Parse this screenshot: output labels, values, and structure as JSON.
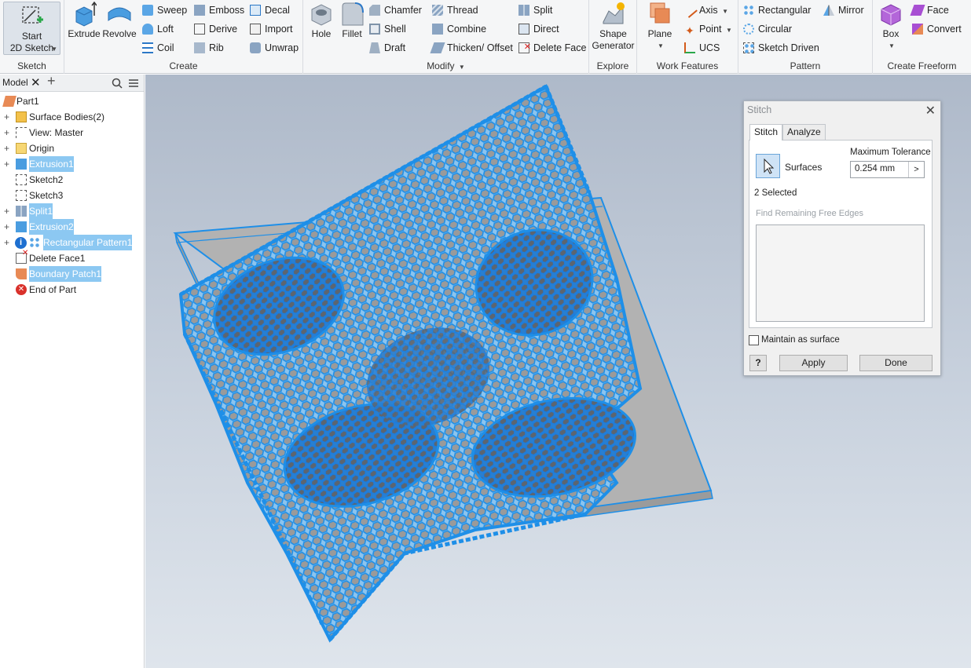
{
  "ribbon": {
    "sketch": {
      "start_label_1": "Start",
      "start_label_2": "2D Sketch",
      "panel": "Sketch"
    },
    "create": {
      "extrude": "Extrude",
      "revolve": "Revolve",
      "sweep": "Sweep",
      "loft": "Loft",
      "coil": "Coil",
      "emboss": "Emboss",
      "derive": "Derive",
      "rib": "Rib",
      "decal": "Decal",
      "import": "Import",
      "unwrap": "Unwrap",
      "panel": "Create"
    },
    "modify": {
      "hole": "Hole",
      "fillet": "Fillet",
      "chamfer": "Chamfer",
      "shell": "Shell",
      "draft": "Draft",
      "thread": "Thread",
      "combine": "Combine",
      "thicken": "Thicken/ Offset",
      "split": "Split",
      "direct": "Direct",
      "delete_face": "Delete Face",
      "panel": "Modify"
    },
    "explore": {
      "shape_1": "Shape",
      "shape_2": "Generator",
      "panel": "Explore"
    },
    "work_features": {
      "plane": "Plane",
      "axis": "Axis",
      "point": "Point",
      "ucs": "UCS",
      "panel": "Work Features"
    },
    "pattern": {
      "rectangular": "Rectangular",
      "circular": "Circular",
      "sketch_driven": "Sketch Driven",
      "mirror": "Mirror",
      "panel": "Pattern"
    },
    "freeform": {
      "box": "Box",
      "face": "Face",
      "convert": "Convert",
      "panel": "Create Freeform"
    }
  },
  "browser": {
    "tab": "Model",
    "items": [
      {
        "label": "Part1"
      },
      {
        "label": "Surface Bodies(2)"
      },
      {
        "label": "View: Master"
      },
      {
        "label": "Origin"
      },
      {
        "label": "Extrusion1"
      },
      {
        "label": "Sketch2"
      },
      {
        "label": "Sketch3"
      },
      {
        "label": "Split1"
      },
      {
        "label": "Extrusion2"
      },
      {
        "label": "Rectangular Pattern1"
      },
      {
        "label": "Delete Face1"
      },
      {
        "label": "Boundary Patch1"
      },
      {
        "label": "End of Part"
      }
    ]
  },
  "dialog": {
    "title": "Stitch",
    "tabs": [
      "Stitch",
      "Analyze"
    ],
    "surfaces_label": "Surfaces",
    "tolerance_label": "Maximum Tolerance",
    "tolerance_value": "0.254 mm",
    "selected_count": "2 Selected",
    "find_edges": "Find Remaining Free Edges",
    "maintain_label": "Maintain as surface",
    "apply": "Apply",
    "done": "Done",
    "help": "?"
  },
  "colors": {
    "selection_blue": "#1e8fe8",
    "plate_gray": "#a9a9a9",
    "viewport_top": "#aeb9c9"
  }
}
